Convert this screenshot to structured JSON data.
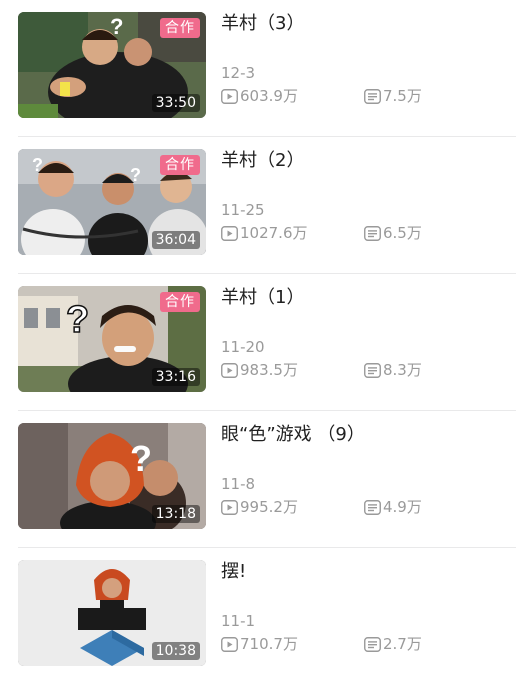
{
  "videos": [
    {
      "title": "羊村（3）",
      "date": "12-3",
      "plays": "603.9万",
      "danmaku": "7.5万",
      "duration": "33:50",
      "badge": "合作"
    },
    {
      "title": "羊村（2）",
      "date": "11-25",
      "plays": "1027.6万",
      "danmaku": "6.5万",
      "duration": "36:04",
      "badge": "合作"
    },
    {
      "title": "羊村（1）",
      "date": "11-20",
      "plays": "983.5万",
      "danmaku": "8.3万",
      "duration": "33:16",
      "badge": "合作"
    },
    {
      "title": "眼“色”游戏 （9）",
      "date": "11-8",
      "plays": "995.2万",
      "danmaku": "4.9万",
      "duration": "13:18",
      "badge": ""
    },
    {
      "title": "摆!",
      "date": "11-1",
      "plays": "710.7万",
      "danmaku": "2.7万",
      "duration": "10:38",
      "badge": ""
    }
  ],
  "icons": {
    "plays": "play-count-icon",
    "danmaku": "danmaku-count-icon"
  },
  "colors": {
    "badge": "#f06b8c",
    "meta_text": "#9a9a9a",
    "title_text": "#212121",
    "divider": "#e9e9ea"
  }
}
